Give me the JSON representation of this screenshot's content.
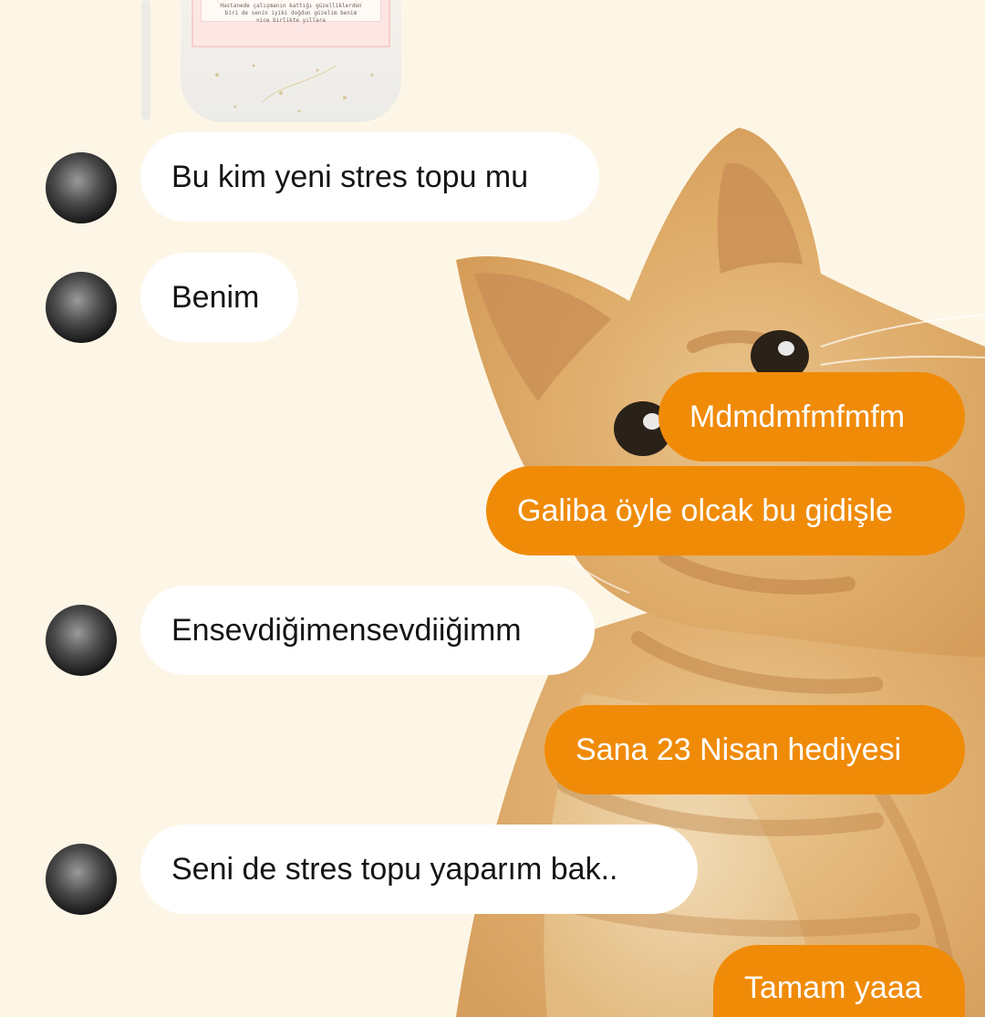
{
  "theme": {
    "background": "#fdf6e6",
    "incoming_bubble": "#ffffff",
    "outgoing_bubble": "#f08b08",
    "incoming_text": "#151515",
    "outgoing_text": "#ffffff"
  },
  "reply_story": {
    "lines": [
      "Hastanede çalışmanın kattığı güzelliklerden",
      "biri de senin iyiki doğdun güzelim benim",
      "nice birlikte yıllara"
    ]
  },
  "messages": [
    {
      "direction": "incoming",
      "text": "Bu kim yeni stres topu mu",
      "avatar": "contact-avatar"
    },
    {
      "direction": "incoming",
      "text": "Benim",
      "avatar": "contact-avatar"
    },
    {
      "direction": "outgoing",
      "text": "Mdmdmfmfmfm"
    },
    {
      "direction": "outgoing",
      "text": "Galiba öyle olcak bu gidişle"
    },
    {
      "direction": "incoming",
      "text": "Ensevdiğimensevdiiğimm",
      "avatar": "contact-avatar"
    },
    {
      "direction": "outgoing",
      "text": "Sana 23 Nisan hediyesi"
    },
    {
      "direction": "incoming",
      "text": "Seni de stres topu yaparım bak..",
      "avatar": "contact-avatar"
    },
    {
      "direction": "outgoing",
      "text": "Tamam yaaa"
    }
  ]
}
